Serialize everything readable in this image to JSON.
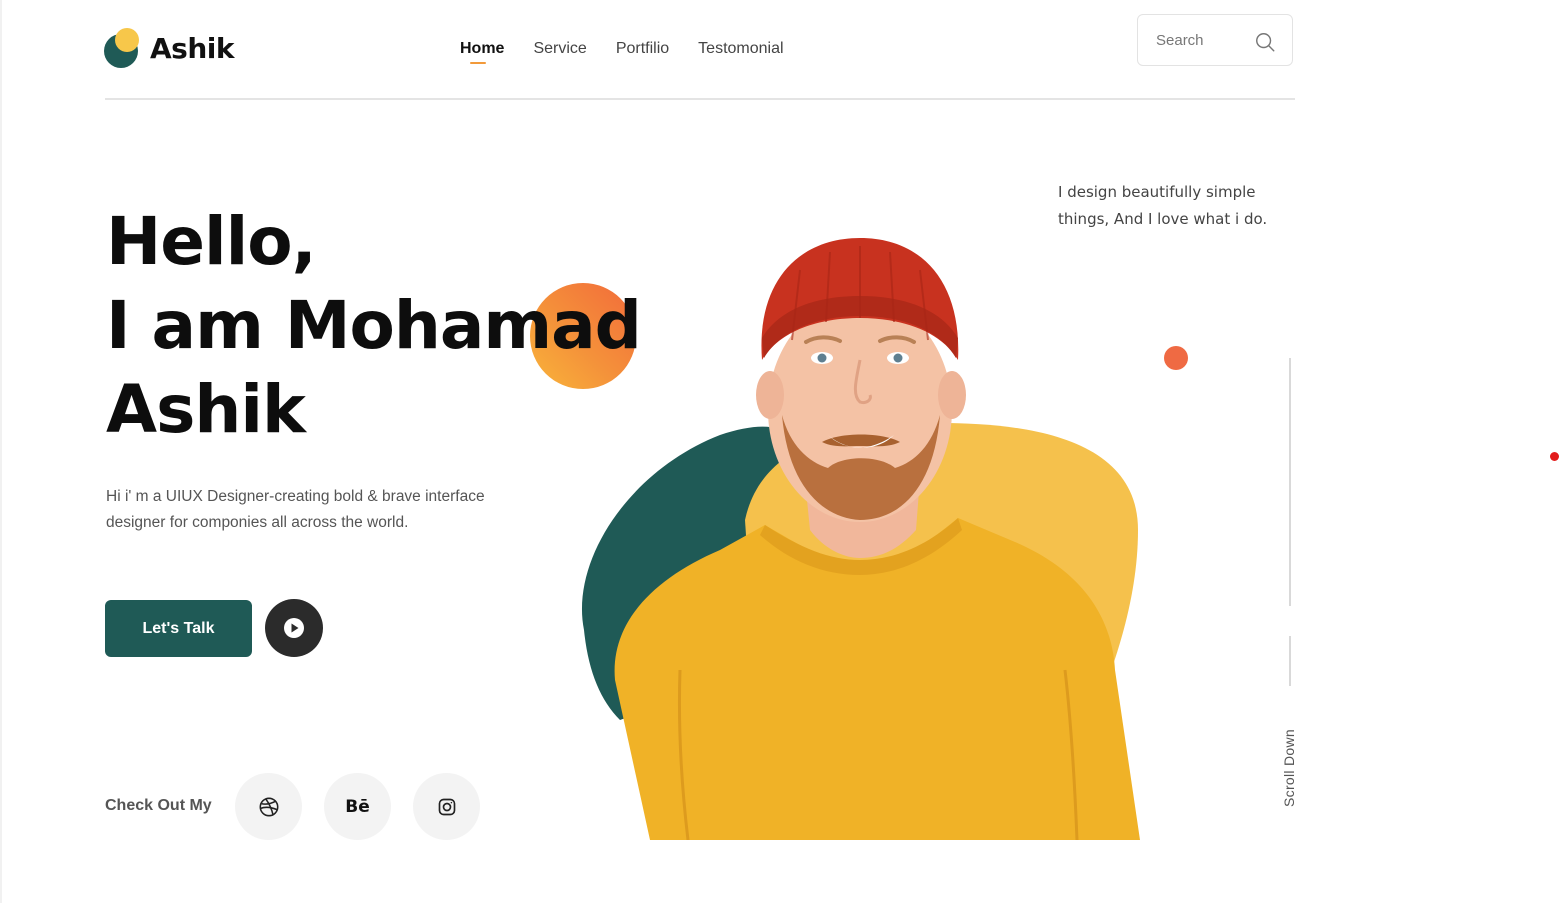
{
  "brand": {
    "name": "Ashik",
    "accent": "#1f5a56",
    "yellow": "#f7c74a",
    "orange": "#f26a3a"
  },
  "nav": {
    "items": [
      {
        "label": "Home",
        "active": true
      },
      {
        "label": "Service",
        "active": false
      },
      {
        "label": "Portfilio",
        "active": false
      },
      {
        "label": "Testomonial",
        "active": false
      }
    ]
  },
  "search": {
    "placeholder": "Search",
    "icon": "search-icon"
  },
  "hero": {
    "line1": "Hello,",
    "line2": "I am Mohamad",
    "line3": "Ashik",
    "intro": "Hi i' m a UIUX Designer-creating bold & brave interface designer for componies all across the world.",
    "cta_label": "Let's Talk",
    "play_icon": "play-icon"
  },
  "social": {
    "label": "Check Out My",
    "links": [
      {
        "icon": "dribbble-icon"
      },
      {
        "icon": "behance-icon",
        "text": "Bē"
      },
      {
        "icon": "instagram-icon"
      }
    ]
  },
  "tagline": "I design beautifully simple things, And I love what i do.",
  "scroll": {
    "label": "Scroll Down"
  }
}
